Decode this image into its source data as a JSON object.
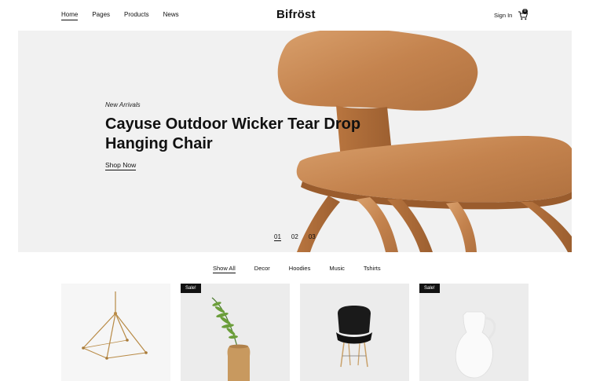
{
  "header": {
    "nav": [
      "Home",
      "Pages",
      "Products",
      "News"
    ],
    "logo": "Bifröst",
    "signin": "Sign In",
    "cart_count": "0"
  },
  "hero": {
    "eyebrow": "New Arrivals",
    "title": "Cayuse Outdoor Wicker Tear Drop Hanging Chair",
    "cta": "Shop Now",
    "slides": [
      "01",
      "02",
      "03"
    ],
    "active_slide": "01"
  },
  "filters": {
    "items": [
      "Show All",
      "Decor",
      "Hoodies",
      "Music",
      "Tshirts"
    ],
    "active": "Show All"
  },
  "products": [
    {
      "image": "chandelier",
      "badge": ""
    },
    {
      "image": "fern-in-vase",
      "badge": "Sale!"
    },
    {
      "image": "black-chair",
      "badge": ""
    },
    {
      "image": "white-pitcher",
      "badge": "Sale!"
    }
  ],
  "colors": {
    "accent": "#111111",
    "hero_bg": "#f1f1f1",
    "wood": "#c98a55"
  }
}
